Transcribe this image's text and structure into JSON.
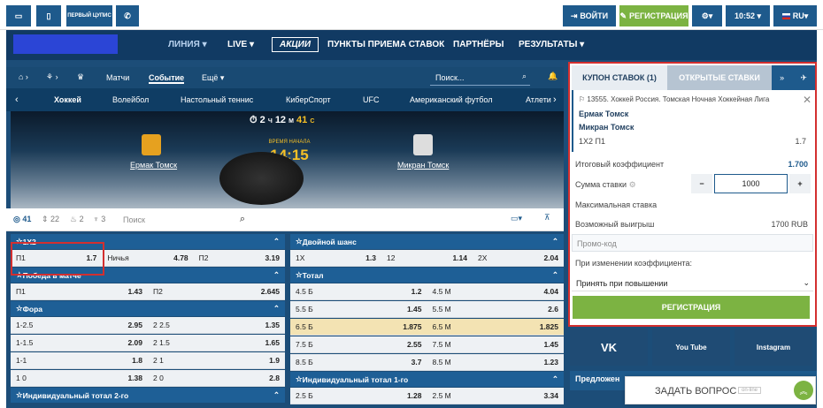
{
  "top": {
    "pervy_kupis": "ПЕРВЫЙ ЦУПИС",
    "login": "ВОЙТИ",
    "register": "РЕГИСТРАЦИЯ",
    "time": "10:52",
    "lang": "RU"
  },
  "nav": [
    "ЛИНИЯ",
    "LIVE",
    "АКЦИИ",
    "ПУНКТЫ ПРИЕМА СТАВОК",
    "ПАРТНЁРЫ",
    "РЕЗУЛЬТАТЫ"
  ],
  "crumbs": {
    "matches": "Матчи",
    "event": "Событие",
    "more": "Ещё",
    "search": "Поиск..."
  },
  "sports": [
    "Хоккей",
    "Волейбол",
    "Настольный теннис",
    "КиберСпорт",
    "UFC",
    "Американский футбол",
    "Атлети"
  ],
  "banner": {
    "timer": "2",
    "timer_unit_h": "Ч",
    "timer_min": "12",
    "timer_unit_m": "М",
    "timer_sec": "41",
    "timer_unit_s": "С",
    "team1": "Ермак Томск",
    "team2": "Микран Томск",
    "start_label": "ВРЕМЯ НАЧАЛА",
    "start_time": "14:15"
  },
  "filters": {
    "count1": "41",
    "count2": "22",
    "count3": "2",
    "count4": "3",
    "search": "Поиск"
  },
  "markets_left": [
    {
      "header": "1Х2",
      "rows": [
        [
          "П1",
          "1.7",
          "Ничья",
          "4.78",
          "П2",
          "3.19"
        ]
      ]
    },
    {
      "header": "Победа в матче",
      "rows": [
        [
          "П1",
          "1.43",
          "П2",
          "2.645"
        ]
      ]
    },
    {
      "header": "Фора",
      "rows": [
        [
          "1-2.5",
          "2.95",
          "2 2.5",
          "1.35"
        ],
        [
          "1-1.5",
          "2.09",
          "2 1.5",
          "1.65"
        ],
        [
          "1-1",
          "1.8",
          "2 1",
          "1.9"
        ],
        [
          "1 0",
          "1.38",
          "2 0",
          "2.8"
        ]
      ]
    },
    {
      "header": "Индивидуальный тотал 2-го",
      "rows": []
    }
  ],
  "markets_right": [
    {
      "header": "Двойной шанс",
      "rows": [
        [
          "1X",
          "1.3",
          "12",
          "1.14",
          "2X",
          "2.04"
        ]
      ]
    },
    {
      "header": "Тотал",
      "rows": [
        [
          "4.5 Б",
          "1.2",
          "4.5 М",
          "4.04"
        ],
        [
          "5.5 Б",
          "1.45",
          "5.5 М",
          "2.6"
        ],
        [
          "6.5 Б",
          "1.875",
          "6.5 М",
          "1.825"
        ],
        [
          "7.5 Б",
          "2.55",
          "7.5 М",
          "1.45"
        ],
        [
          "8.5 Б",
          "3.7",
          "8.5 М",
          "1.23"
        ]
      ]
    },
    {
      "header": "Индивидуальный тотал 1-го",
      "rows": [
        [
          "2.5 Б",
          "1.28",
          "2.5 М",
          "3.34"
        ]
      ]
    }
  ],
  "coupon": {
    "tab1": "КУПОН СТАВОК (1)",
    "tab2": "ОТКРЫТЫЕ СТАВКИ",
    "event": "13555. Хоккей Россия. Томская Ночная Хоккейная Лига",
    "team1": "Ермак Томск",
    "team2": "Микран Томск",
    "bet": "1Х2 П1",
    "odd": "1.7",
    "total_label": "Итоговый коэффициент",
    "total_val": "1.700",
    "sum_label": "Сумма ставки",
    "sum_val": "1000",
    "max_label": "Максимальная ставка",
    "win_label": "Возможный выигрыш",
    "win_val": "1700 RUB",
    "promo_ph": "Промо-код",
    "change_label": "При изменении коэффициента:",
    "change_val": "Принять при повышении",
    "register": "РЕГИСТРАЦИЯ"
  },
  "social": [
    "VK",
    "You Tube",
    "Instagram"
  ],
  "offers": "Предложен",
  "ask": "ЗАДАТЬ ВОПРОС",
  "ask_status": "on-line"
}
